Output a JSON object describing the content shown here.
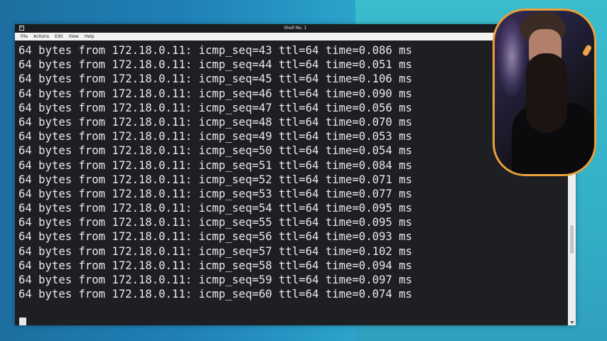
{
  "window": {
    "title": "Shell No. 1"
  },
  "menu": {
    "items": [
      "File",
      "Actions",
      "Edit",
      "View",
      "Help"
    ]
  },
  "terminal": {
    "lines": [
      "64 bytes from 172.18.0.11: icmp_seq=43 ttl=64 time=0.086 ms",
      "64 bytes from 172.18.0.11: icmp_seq=44 ttl=64 time=0.051 ms",
      "64 bytes from 172.18.0.11: icmp_seq=45 ttl=64 time=0.106 ms",
      "64 bytes from 172.18.0.11: icmp_seq=46 ttl=64 time=0.090 ms",
      "64 bytes from 172.18.0.11: icmp_seq=47 ttl=64 time=0.056 ms",
      "64 bytes from 172.18.0.11: icmp_seq=48 ttl=64 time=0.070 ms",
      "64 bytes from 172.18.0.11: icmp_seq=49 ttl=64 time=0.053 ms",
      "64 bytes from 172.18.0.11: icmp_seq=50 ttl=64 time=0.054 ms",
      "64 bytes from 172.18.0.11: icmp_seq=51 ttl=64 time=0.084 ms",
      "64 bytes from 172.18.0.11: icmp_seq=52 ttl=64 time=0.071 ms",
      "64 bytes from 172.18.0.11: icmp_seq=53 ttl=64 time=0.077 ms",
      "64 bytes from 172.18.0.11: icmp_seq=54 ttl=64 time=0.095 ms",
      "64 bytes from 172.18.0.11: icmp_seq=55 ttl=64 time=0.095 ms",
      "64 bytes from 172.18.0.11: icmp_seq=56 ttl=64 time=0.093 ms",
      "64 bytes from 172.18.0.11: icmp_seq=57 ttl=64 time=0.102 ms",
      "64 bytes from 172.18.0.11: icmp_seq=58 ttl=64 time=0.094 ms",
      "64 bytes from 172.18.0.11: icmp_seq=59 ttl=64 time=0.097 ms",
      "64 bytes from 172.18.0.11: icmp_seq=60 ttl=64 time=0.074 ms"
    ]
  },
  "colors": {
    "terminal_bg": "#1e1f22",
    "terminal_fg": "#e9e9e9",
    "webcam_border": "#e9a13a"
  }
}
